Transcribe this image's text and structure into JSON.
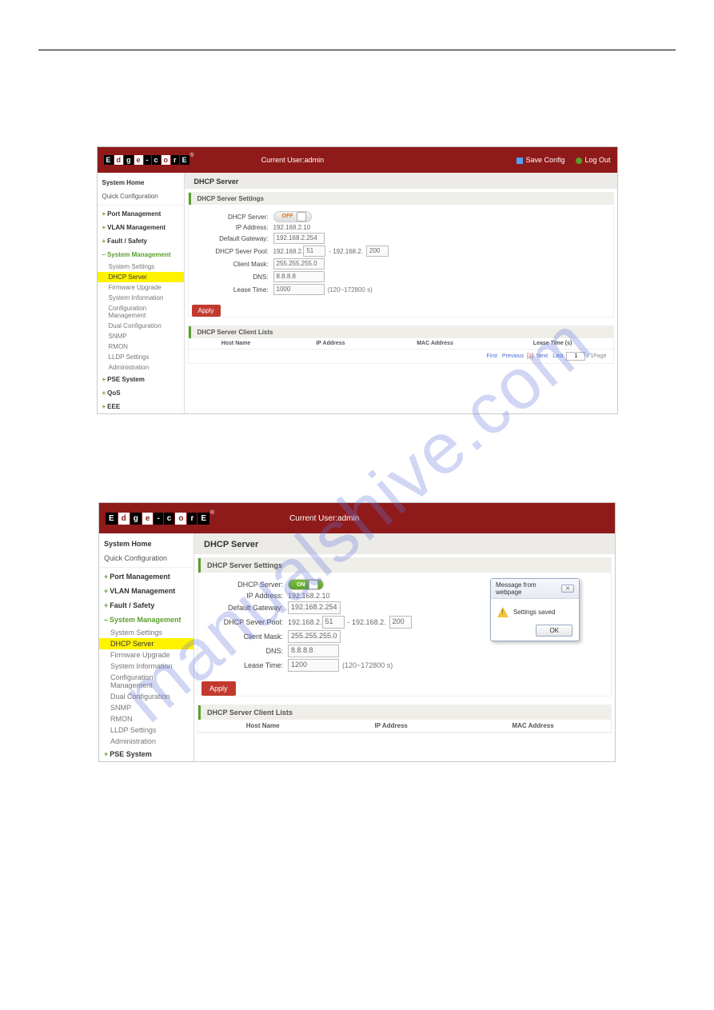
{
  "watermark": "manualshive.com",
  "brand_letters": [
    "E",
    "d",
    "g",
    "e",
    "-",
    "c",
    "o",
    "r",
    "E"
  ],
  "brand_reg": "®",
  "header": {
    "current_user_label": "Current User:admin",
    "save_config": "Save Config",
    "log_out": "Log Out"
  },
  "sidebar": {
    "system_home": "System Home",
    "quick_config": "Quick Configuration",
    "port_mgmt": "Port Management",
    "vlan_mgmt": "VLAN Management",
    "fault_safety": "Fault / Safety",
    "sys_mgmt": "System Management",
    "children": {
      "system_settings": "System Settings",
      "dhcp_server": "DHCP Server",
      "firmware_upgrade": "Firmware Upgrade",
      "system_information": "System Information",
      "config_mgmt": "Configuration Management",
      "dual_config": "Dual Configuration",
      "snmp": "SNMP",
      "rmon": "RMON",
      "lldp_settings": "LLDP Settings",
      "administration": "Administration"
    },
    "pse_system": "PSE System",
    "qos": "QoS",
    "eee": "EEE"
  },
  "page_title": "DHCP Server",
  "sections": {
    "settings": "DHCP Server Settings",
    "client_lists": "DHCP Server Client Lists"
  },
  "form": {
    "labels": {
      "dhcp_server": "DHCP Server:",
      "ip_address": "IP Address:",
      "default_gateway": "Default Gateway:",
      "pool": "DHCP Sever Pool:",
      "client_mask": "Client Mask:",
      "dns": "DNS:",
      "lease_time": "Lease Time:"
    },
    "lease_hint": "(120~172800 s)",
    "apply": "Apply",
    "pool_dash": "- 192.168.2.",
    "toggle_off": "OFF",
    "toggle_on": "ON"
  },
  "shot_a": {
    "ip_address": "192.168.2.10",
    "default_gateway": "192.168.2.254",
    "pool_start": "51",
    "pool_end": "200",
    "client_mask": "255.255.255.0",
    "dns": "8.8.8.8",
    "lease_time": "1000"
  },
  "shot_b": {
    "ip_address": "192.168.2.10",
    "default_gateway": "192.168.2.254",
    "pool_start": "51",
    "pool_end": "200",
    "client_mask": "255.255.255.0",
    "dns": "8.8.8.8",
    "lease_time": "1200"
  },
  "table": {
    "host_name": "Host Name",
    "ip_address": "IP Address",
    "mac_address": "MAC Address",
    "lease_time": "Lease Time (s)"
  },
  "pager": {
    "first": "First",
    "previous": "Previous",
    "current": "[1]",
    "next": "Next",
    "last": "Last",
    "page_value": "1",
    "per_page": "/ 1Page"
  },
  "modal": {
    "title": "Message from webpage",
    "message": "Settings saved",
    "ok": "OK"
  }
}
